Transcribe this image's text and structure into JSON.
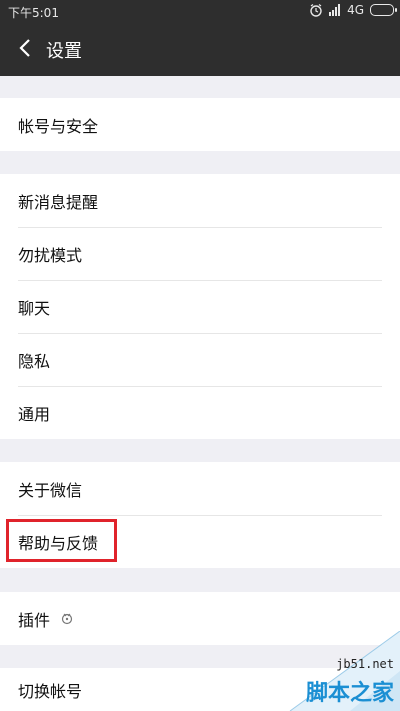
{
  "status_bar": {
    "time": "下午5:01",
    "network": "4G"
  },
  "header": {
    "title": "设置"
  },
  "groups": [
    {
      "items": [
        "帐号与安全"
      ]
    },
    {
      "items": [
        "新消息提醒",
        "勿扰模式",
        "聊天",
        "隐私",
        "通用"
      ]
    },
    {
      "items": [
        "关于微信",
        "帮助与反馈"
      ]
    },
    {
      "items": [
        "插件"
      ]
    },
    {
      "items": [
        "切换帐号"
      ]
    }
  ],
  "watermark": {
    "site": "jb51.net",
    "text": "脚本之家"
  },
  "icons": [
    "back-arrow-icon",
    "alarm-icon",
    "signal-icon",
    "battery-icon",
    "plugin-icon"
  ],
  "colors": {
    "header_bg": "#2e2e2e",
    "page_bg": "#efeff4",
    "highlight": "#e0232b",
    "watermark": "#1b8fd3"
  }
}
